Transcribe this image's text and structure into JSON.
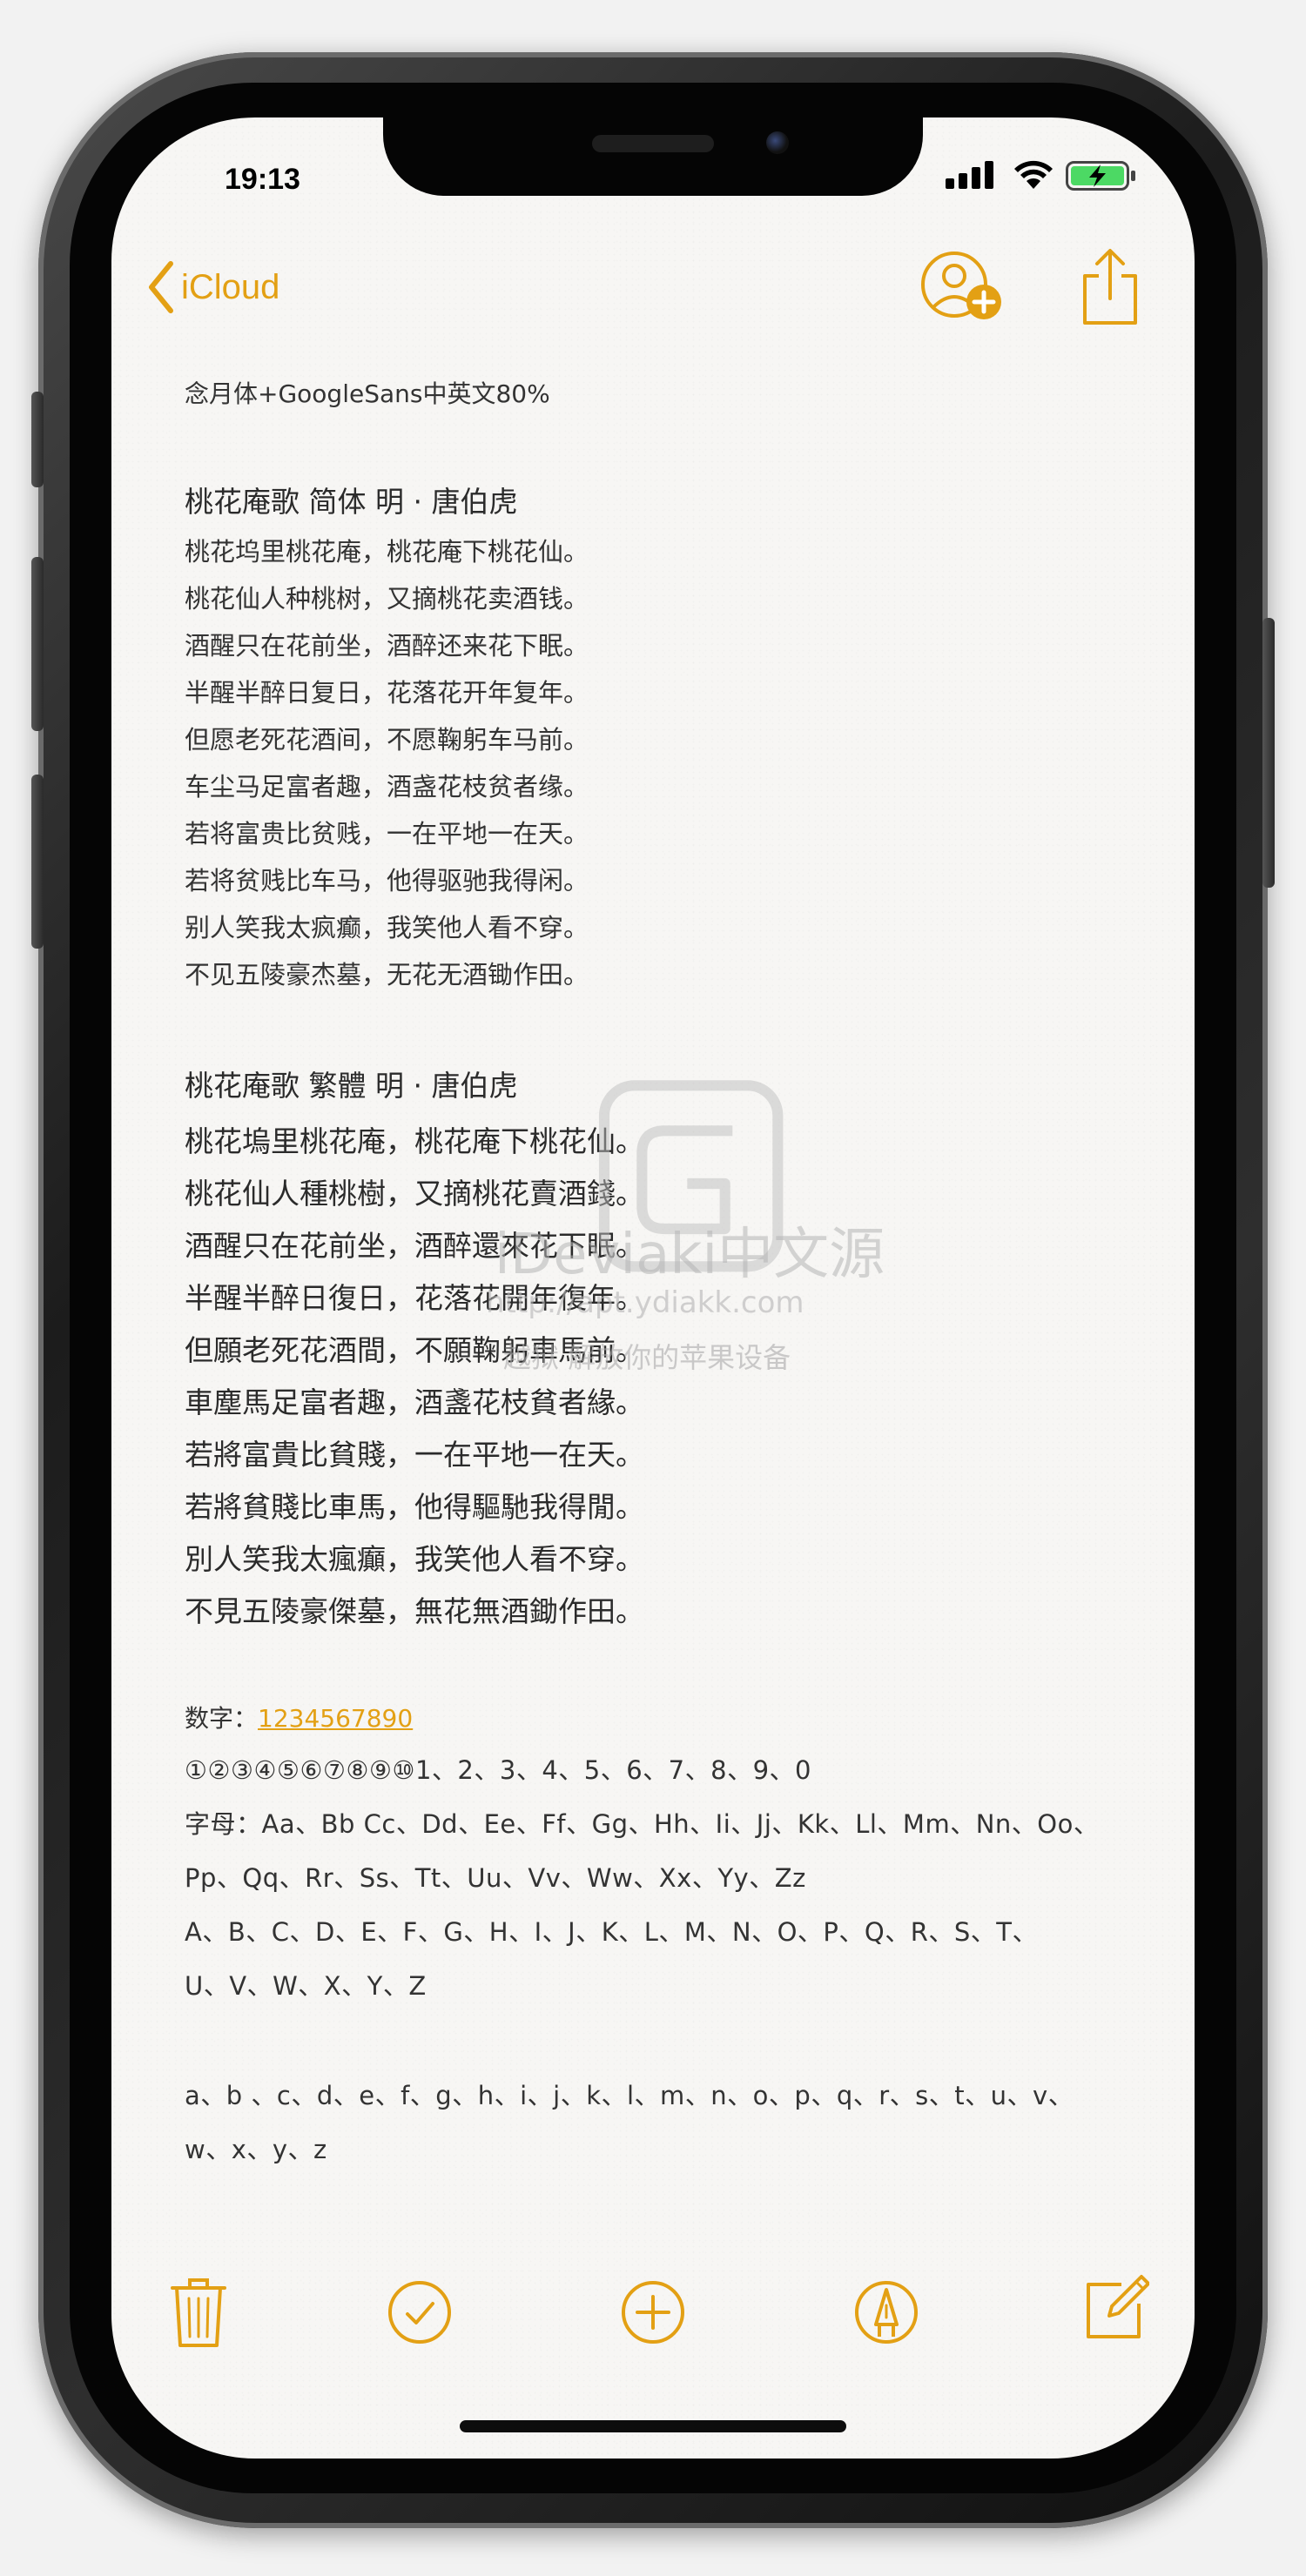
{
  "status_bar": {
    "time": "19:13"
  },
  "nav": {
    "back_label": "iCloud"
  },
  "note": {
    "font_caption": "念月体+GoogleSans中英文80%",
    "poem_simplified": {
      "title": "桃花庵歌  简体   明 · 唐伯虎",
      "lines": [
        "桃花坞里桃花庵，桃花庵下桃花仙。",
        "桃花仙人种桃树，又摘桃花卖酒钱。",
        "酒醒只在花前坐，酒醉还来花下眠。",
        "半醒半醉日复日，花落花开年复年。",
        "但愿老死花酒间，不愿鞠躬车马前。",
        "车尘马足富者趣，酒盏花枝贫者缘。",
        "若将富贵比贫贱，一在平地一在天。",
        "若将贫贱比车马，他得驱驰我得闲。",
        "别人笑我太疯癫，我笑他人看不穿。",
        "不见五陵豪杰墓，无花无酒锄作田。"
      ]
    },
    "poem_traditional": {
      "title": "桃花庵歌  繁體      明 · 唐伯虎",
      "lines": [
        "桃花塢里桃花庵，桃花庵下桃花仙。",
        "桃花仙人種桃樹，又摘桃花賣酒錢。",
        "酒醒只在花前坐，酒醉還來花下眠。",
        "半醒半醉日復日，花落花開年復年。",
        "但願老死花酒間，不願鞠躬車馬前。",
        "車塵馬足富者趣，酒盞花枝貧者緣。",
        "若將富貴比貧賤，一在平地一在天。",
        "若將貧賤比車馬，他得驅馳我得閒。",
        "別人笑我太瘋癲，我笑他人看不穿。",
        "不見五陵豪傑墓，無花無酒鋤作田。"
      ]
    },
    "digits_label": "数字：",
    "digits_value": "1234567890",
    "circled_digits": "①②③④⑤⑥⑦⑧⑨⑩1、2、3、4、5、6、7、8、9、0",
    "letters_line1": "字母：Aa、Bb Cc、Dd、Ee、Ff、Gg、Hh、Ii、Jj、Kk、Ll、Mm、Nn、Oo、",
    "letters_line2": "Pp、Qq、Rr、Ss、Tt、Uu、Vv、Ww、Xx、Yy、Zz",
    "upper_line1": "A、B、C、D、E、F、G、H、I、J、K、L、M、N、O、P、Q、R、S、T、",
    "upper_line2": "U、V、W、X、Y、Z",
    "lower_line1": "a、b 、c、d、e、f、g、h、i、j、k、l、m、n、o、p、q、r、s、t、u、v、",
    "lower_line2": "w、x、y、z"
  },
  "watermark": {
    "site": "iDeviaki中文源",
    "url": "http://apt.ydiakk.com",
    "slogan": "越狱 解放你的苹果设备"
  },
  "colors": {
    "accent": "#e3a014",
    "text": "#333333",
    "paper": "#f7f6f4"
  },
  "icons": {
    "back": "chevron-left-icon",
    "add_person": "add-person-icon",
    "share": "share-icon",
    "trash": "trash-icon",
    "checklist": "checkmark-circle-icon",
    "add": "plus-circle-icon",
    "markup": "pen-tip-icon",
    "compose": "compose-icon"
  }
}
